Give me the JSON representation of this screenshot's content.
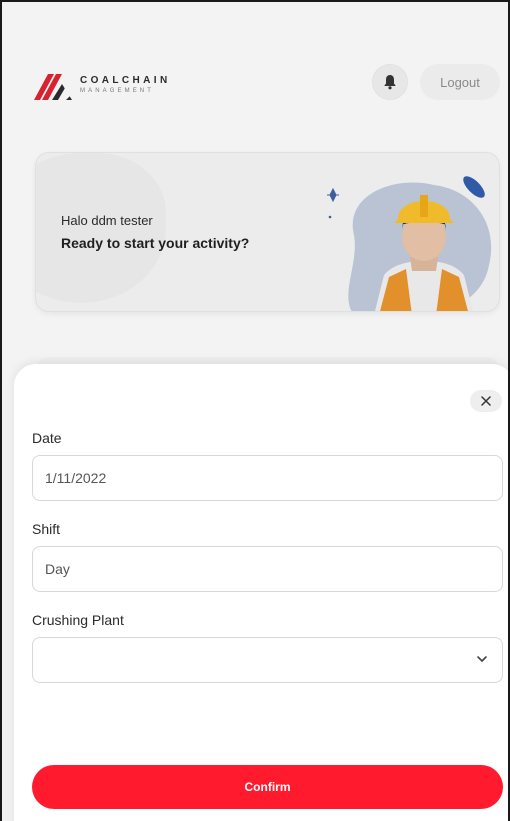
{
  "header": {
    "logo_word": "COALCHAIN",
    "logo_sub": "MANAGEMENT",
    "logout_label": "Logout"
  },
  "welcome": {
    "greeting": "Halo ddm tester",
    "prompt": "Ready to start your activity?"
  },
  "modal": {
    "date": {
      "label": "Date",
      "value": "1/11/2022"
    },
    "shift": {
      "label": "Shift",
      "value": "Day"
    },
    "crushing_plant": {
      "label": "Crushing Plant",
      "value": ""
    },
    "confirm_label": "Confirm"
  },
  "icons": {
    "bell": "bell-icon",
    "close": "close-icon",
    "chevron": "chevron-down-icon"
  },
  "colors": {
    "accent": "#ff1a2e",
    "logo_red": "#d6232f",
    "logo_dark": "#2b2b2b"
  }
}
